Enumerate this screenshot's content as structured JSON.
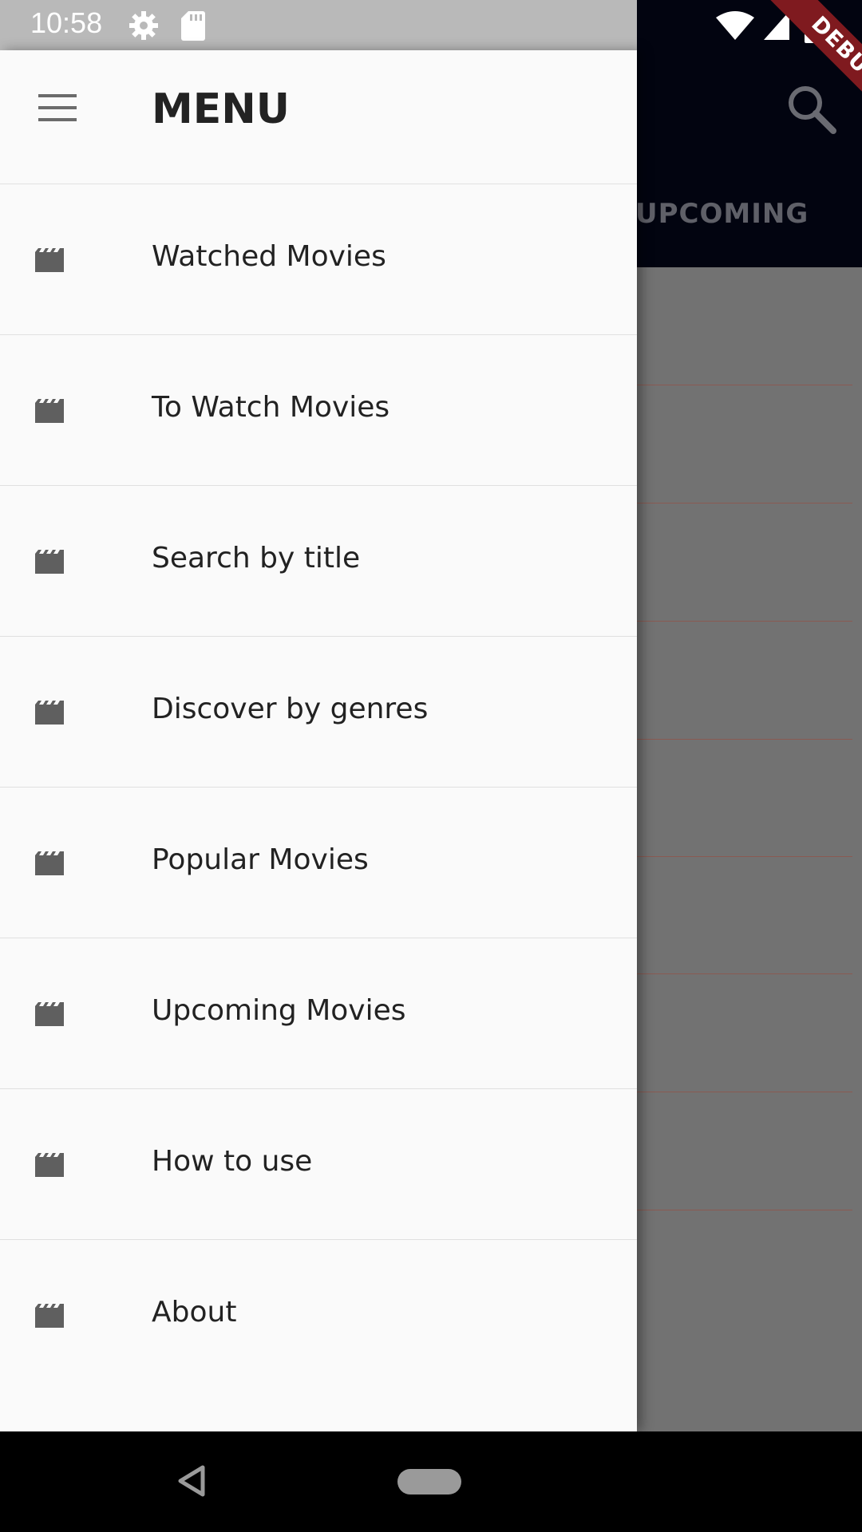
{
  "status_bar": {
    "time": "10:58",
    "icons": [
      "settings-icon",
      "sd-card-icon",
      "wifi-icon",
      "signal-icon",
      "battery-charging-icon"
    ],
    "debug_banner": "DEBUG"
  },
  "app_bar": {
    "visible_tab": "UPCOMING",
    "actions": [
      "search-icon"
    ],
    "background": "#020410"
  },
  "drawer": {
    "title": "MENU",
    "header_icon": "hamburger-icon",
    "items": [
      {
        "label": "Watched Movies",
        "icon": "movie-clapper-icon"
      },
      {
        "label": "To Watch Movies",
        "icon": "movie-clapper-icon"
      },
      {
        "label": "Search by title",
        "icon": "movie-clapper-icon"
      },
      {
        "label": "Discover by genres",
        "icon": "movie-clapper-icon"
      },
      {
        "label": "Popular Movies",
        "icon": "movie-clapper-icon"
      },
      {
        "label": "Upcoming Movies",
        "icon": "movie-clapper-icon"
      },
      {
        "label": "How to use",
        "icon": "movie-clapper-icon"
      },
      {
        "label": "About",
        "icon": "movie-clapper-icon"
      }
    ]
  },
  "nav_bar": {
    "buttons": [
      "back-icon",
      "home-pill"
    ]
  },
  "colors": {
    "drawer_bg": "#fafafa",
    "scrim": "#727272",
    "list_divider": "#8a5a52",
    "debug_ribbon": "#7f1a1f"
  }
}
